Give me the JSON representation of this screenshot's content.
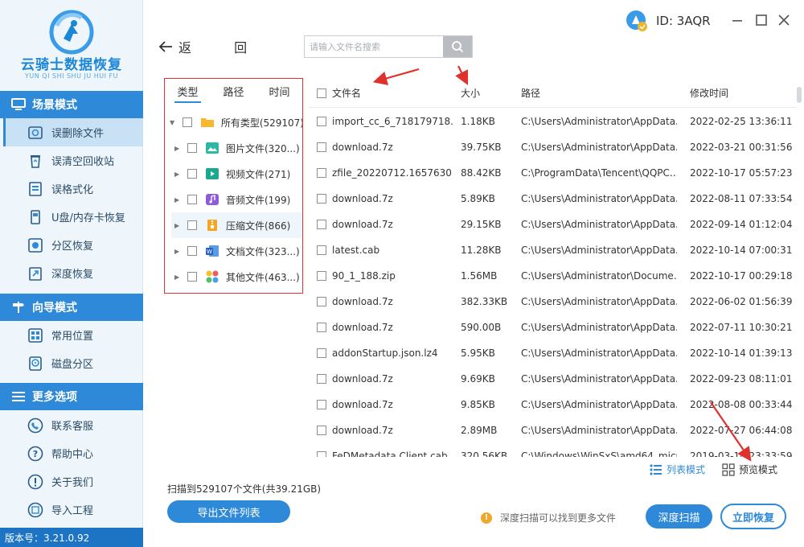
{
  "app": {
    "title": "云骑士数据恢复",
    "subtitle": "YUN QI SHI SHU JU HUI FU",
    "version": "版本号：3.21.0.92",
    "user_id": "ID: 3AQR",
    "accent": "#2e8ad8"
  },
  "sidebar": {
    "sections": [
      {
        "title": "场景模式",
        "icon": "monitor-icon",
        "items": [
          {
            "label": "误删除文件",
            "icon": "delete-file-icon",
            "active": true
          },
          {
            "label": "误清空回收站",
            "icon": "recycle-bin-icon"
          },
          {
            "label": "误格式化",
            "icon": "format-icon"
          },
          {
            "label": "U盘/内存卡恢复",
            "icon": "usb-drive-icon"
          },
          {
            "label": "分区恢复",
            "icon": "partition-icon"
          },
          {
            "label": "深度恢复",
            "icon": "deep-recovery-icon"
          }
        ]
      },
      {
        "title": "向导模式",
        "icon": "signpost-icon",
        "items": [
          {
            "label": "常用位置",
            "icon": "windows-icon"
          },
          {
            "label": "磁盘分区",
            "icon": "disk-icon"
          }
        ]
      },
      {
        "title": "更多选项",
        "icon": "menu-icon",
        "items": [
          {
            "label": "联系客服",
            "icon": "phone-icon"
          },
          {
            "label": "帮助中心",
            "icon": "help-icon"
          },
          {
            "label": "关于我们",
            "icon": "info-icon"
          },
          {
            "label": "导入工程",
            "icon": "import-icon"
          }
        ]
      }
    ]
  },
  "nav": {
    "back_label": "返 回",
    "search_placeholder": "请输入文件名搜索"
  },
  "tree": {
    "tabs": [
      "类型",
      "路径",
      "时间"
    ],
    "active_tab": 0,
    "items": [
      {
        "label": "所有类型(529107)",
        "icon": "folder-icon",
        "expanded": true
      },
      {
        "label": "图片文件(320...)",
        "icon": "image-icon"
      },
      {
        "label": "视频文件(271)",
        "icon": "video-icon"
      },
      {
        "label": "音频文件(199)",
        "icon": "audio-icon"
      },
      {
        "label": "压缩文件(866)",
        "icon": "archive-icon",
        "selected": true
      },
      {
        "label": "文档文件(323...)",
        "icon": "document-icon"
      },
      {
        "label": "其他文件(463...)",
        "icon": "other-icon"
      }
    ]
  },
  "table": {
    "headers": {
      "name": "文件名",
      "size": "大小",
      "path": "路径",
      "time": "修改时间"
    },
    "rows": [
      {
        "name": "import_cc_6_718179718...",
        "size": "1.18KB",
        "path": "C:\\Users\\Administrator\\AppData...",
        "time": "2022-02-25 13:36:11"
      },
      {
        "name": "download.7z",
        "size": "39.75KB",
        "path": "C:\\Users\\Administrator\\AppData...",
        "time": "2022-03-21 00:31:56"
      },
      {
        "name": "zfile_20220712.1657630...",
        "size": "88.42KB",
        "path": "C:\\ProgramData\\Tencent\\QQPC...",
        "time": "2022-10-17 05:57:23"
      },
      {
        "name": "download.7z",
        "size": "5.89KB",
        "path": "C:\\Users\\Administrator\\AppData...",
        "time": "2022-08-11 07:33:54"
      },
      {
        "name": "download.7z",
        "size": "29.15KB",
        "path": "C:\\Users\\Administrator\\AppData...",
        "time": "2022-09-14 01:12:04"
      },
      {
        "name": "latest.cab",
        "size": "11.28KB",
        "path": "C:\\Users\\Administrator\\AppData...",
        "time": "2022-10-14 07:00:31"
      },
      {
        "name": "90_1_188.zip",
        "size": "1.56MB",
        "path": "C:\\Users\\Administrator\\Docume...",
        "time": "2022-10-17 00:29:18"
      },
      {
        "name": "download.7z",
        "size": "382.33KB",
        "path": "C:\\Users\\Administrator\\AppData...",
        "time": "2022-06-02 01:56:39"
      },
      {
        "name": "download.7z",
        "size": "590.00B",
        "path": "C:\\Users\\Administrator\\AppData...",
        "time": "2022-07-11 10:30:21"
      },
      {
        "name": "addonStartup.json.lz4",
        "size": "5.95KB",
        "path": "C:\\Users\\Administrator\\AppData...",
        "time": "2022-10-14 01:39:13"
      },
      {
        "name": "download.7z",
        "size": "9.69KB",
        "path": "C:\\Users\\Administrator\\AppData...",
        "time": "2022-09-23 08:11:01"
      },
      {
        "name": "download.7z",
        "size": "9.85KB",
        "path": "C:\\Users\\Administrator\\AppData...",
        "time": "2022-08-08 00:33:44"
      },
      {
        "name": "download.7z",
        "size": "2.89MB",
        "path": "C:\\Users\\Administrator\\AppData...",
        "time": "2022-07-27 06:44:08"
      },
      {
        "name": "FeDMetadata.Client.cab",
        "size": "320.56KB",
        "path": "C:\\Windows\\WinSxS\\amd64_micr...",
        "time": "2019-03-14 23:33:59"
      }
    ]
  },
  "footer": {
    "view_list": "列表模式",
    "view_preview": "预览模式",
    "scan_info": "扫描到529107个文件(共39.21GB)",
    "export_button": "导出文件列表",
    "hint": "深度扫描可以找到更多文件",
    "deep_scan_button": "深度扫描",
    "recover_button": "立即恢复"
  }
}
